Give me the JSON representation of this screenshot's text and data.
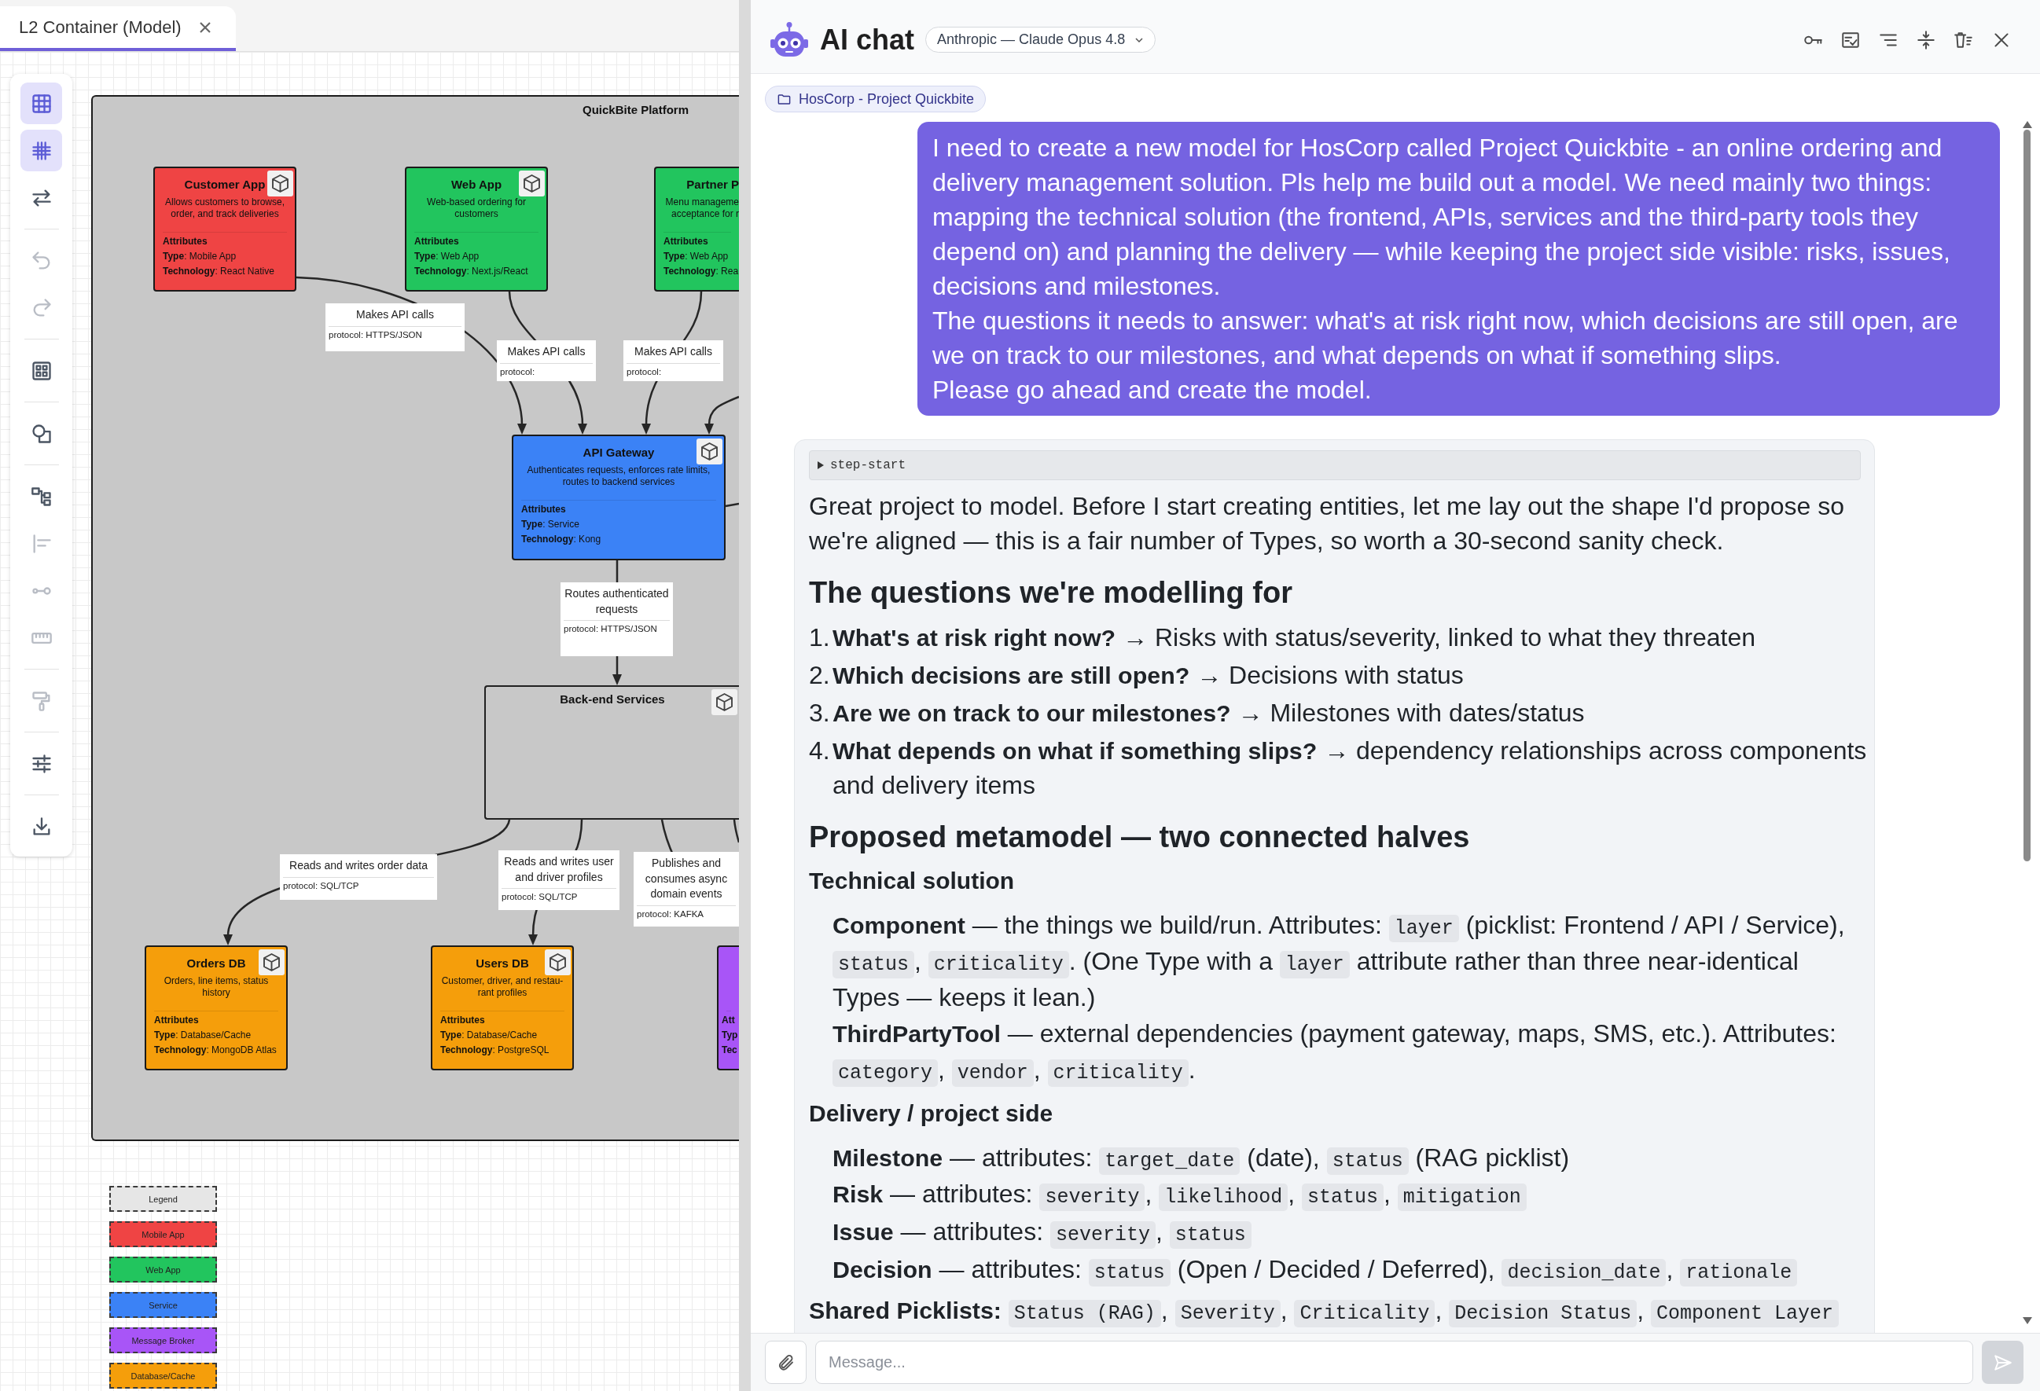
{
  "editor_tab": {
    "title": "L2 Container (Model)",
    "selected": true
  },
  "toolbar": {
    "tools": [
      {
        "on": true,
        "disabled": false
      },
      {
        "on": true,
        "disabled": false
      },
      {
        "on": false,
        "disabled": false
      },
      {
        "on": false,
        "disabled": true
      },
      {
        "on": false,
        "disabled": true
      },
      {
        "on": false,
        "disabled": false
      },
      {
        "on": false,
        "disabled": false
      },
      {
        "on": false,
        "disabled": false
      },
      {
        "on": false,
        "disabled": true
      },
      {
        "on": false,
        "disabled": true
      },
      {
        "on": false,
        "disabled": true
      },
      {
        "on": false,
        "disabled": true
      },
      {
        "on": false,
        "disabled": false
      },
      {
        "on": false,
        "disabled": false
      }
    ]
  },
  "diagram": {
    "title": "QuickBite Platform",
    "nodes": [
      {
        "title": "Customer App",
        "description": "Allows customers to browse, order, and track deliveries",
        "color": "#ef4444",
        "attributes_heading": "Attributes",
        "attributes": [
          "**Type**: Mobile App",
          "**Technology**: React Native"
        ]
      },
      {
        "title": "Web App",
        "description": "Web-based ordering for customers",
        "color": "#22c55e",
        "attributes_heading": "Attributes",
        "attributes": [
          "**Type**: Web App",
          "**Technology**: Next.js/React"
        ]
      },
      {
        "title": "Partner P",
        "description": "Menu manageme\nacceptance for r",
        "color": "#22c55e",
        "attributes_heading": "Attributes",
        "attributes": [
          "**Type**: Web App",
          "**Technology**: Rea"
        ]
      },
      {
        "title": "API Gateway",
        "description": "Authenticates requests, enforces rate limits, routes to backend services",
        "color": "#3b82f6",
        "attributes_heading": "Attributes",
        "attributes": [
          "**Type**: Service",
          "**Technology**: Kong"
        ]
      },
      {
        "title": "Orders DB",
        "description": "Orders, line items, status history",
        "color": "#f59e0b",
        "attributes_heading": "Attributes",
        "attributes": [
          "**Type**: Database/Cache",
          "**Technology**: MongoDB Atlas"
        ]
      },
      {
        "title": "Users DB",
        "description": "Customer, driver, and restau-\nrant profiles",
        "color": "#f59e0b",
        "attributes_heading": "Attributes",
        "attributes": [
          "**Type**: Database/Cache",
          "**Technology**: PostgreSQL"
        ]
      },
      {
        "color": "#a855f7",
        "attributes_heading": "Att",
        "attributes": [
          "**Typ**",
          "**Tec**"
        ]
      }
    ],
    "group_title": "Back-end Services",
    "edges": [
      {
        "label": "Makes API calls",
        "protocol": "protocol: HTTPS/JSON"
      },
      {
        "label": "Makes API calls",
        "protocol": "protocol:"
      },
      {
        "label": "Makes API calls",
        "protocol": "protocol:"
      },
      {
        "label": "Routes authenticated requests",
        "protocol": "protocol: HTTPS/JSON"
      },
      {
        "label": "Reads and writes order data",
        "protocol": "protocol: SQL/TCP"
      },
      {
        "label": "Reads and writes user and driver profiles",
        "protocol": "protocol: SQL/TCP"
      },
      {
        "label": "Publishes and consumes async domain events",
        "protocol": "protocol: KAFKA"
      }
    ]
  },
  "legend": {
    "title": "Legend",
    "items": [
      {
        "label": "Mobile App",
        "color": "#ef4444"
      },
      {
        "label": "Web App",
        "color": "#22c55e"
      },
      {
        "label": "Service",
        "color": "#3b82f6"
      },
      {
        "label": "Message Broker",
        "color": "#a855f7"
      },
      {
        "label": "Database/Cache",
        "color": "#f59e0b"
      }
    ]
  },
  "chat": {
    "title": "AI chat",
    "model": "Anthropic — Claude Opus 4.8",
    "project": "HosCorp - Project Quickbite",
    "messages": [
      {
        "kind": "user",
        "text": "I need to create a new model for HosCorp called Project Quickbite - an online ordering and delivery management solution. Pls help me build out a model. We need mainly two things: mapping the technical solution (the frontend, APIs, services and the third-party tools they depend on) and planning the delivery — while keeping the project side visible: risks, issues, decisions and milestones.\nThe questions it needs to answer: what's at risk right now, which decisions are still open, are we on track to our milestones, and what depends on what if something slips.\nPlease go ahead and create the model."
      },
      {
        "kind": "assistant",
        "step": {
          "label": "step-start",
          "expanded": false
        },
        "blocks": [
          {
            "kind": "paragraph",
            "parts": [
              {
                "kind": "text",
                "text": "Great project to model. Before I start creating entities, let me lay out the shape I'd propose so we're aligned — this is a fair number of Types, so worth a 30-second sanity check."
              }
            ]
          },
          {
            "kind": "heading",
            "text": "The questions we're modelling for"
          },
          {
            "kind": "list",
            "items": [
              {
                "number": "1.",
                "parts": [
                  {
                    "kind": "bold",
                    "text": "What's at risk right now?"
                  },
                  {
                    "kind": "text",
                    "text": " → Risks with status/severity, linked to what they threaten"
                  }
                ]
              },
              {
                "number": "2.",
                "parts": [
                  {
                    "kind": "bold",
                    "text": "Which decisions are still open?"
                  },
                  {
                    "kind": "text",
                    "text": " → Decisions with status"
                  }
                ]
              },
              {
                "number": "3.",
                "parts": [
                  {
                    "kind": "bold",
                    "text": "Are we on track to our milestones?"
                  },
                  {
                    "kind": "text",
                    "text": " → Milestones with dates/status"
                  }
                ]
              },
              {
                "number": "4.",
                "parts": [
                  {
                    "kind": "bold",
                    "text": "What depends on what if something slips?"
                  },
                  {
                    "kind": "text",
                    "text": " → dependency relationships across components and delivery items"
                  }
                ]
              }
            ]
          },
          {
            "kind": "heading",
            "text": "Proposed metamodel — two connected halves"
          },
          {
            "kind": "subheading",
            "text": "Technical solution"
          },
          {
            "kind": "entry",
            "parts": [
              {
                "kind": "bold",
                "text": "Component"
              },
              {
                "kind": "text",
                "text": " — the things we build/run. Attributes: "
              },
              {
                "kind": "code",
                "text": "layer"
              },
              {
                "kind": "text",
                "text": " (picklist: Frontend / API / Service), "
              },
              {
                "kind": "code",
                "text": "status"
              },
              {
                "kind": "text",
                "text": ", "
              },
              {
                "kind": "code",
                "text": "criticality"
              },
              {
                "kind": "text",
                "text": ". (One Type with a "
              },
              {
                "kind": "code",
                "text": "layer"
              },
              {
                "kind": "text",
                "text": " attribute rather than three near-identical Types — keeps it lean.)"
              }
            ]
          },
          {
            "kind": "entry",
            "parts": [
              {
                "kind": "bold",
                "text": "ThirdPartyTool"
              },
              {
                "kind": "text",
                "text": " — external dependencies (payment gateway, maps, SMS, etc.). Attributes: "
              },
              {
                "kind": "code",
                "text": "category"
              },
              {
                "kind": "text",
                "text": ", "
              },
              {
                "kind": "code",
                "text": "vendor"
              },
              {
                "kind": "text",
                "text": ", "
              },
              {
                "kind": "code",
                "text": "criticality"
              },
              {
                "kind": "text",
                "text": "."
              }
            ]
          },
          {
            "kind": "subheading",
            "text": "Delivery / project side"
          },
          {
            "kind": "entry",
            "parts": [
              {
                "kind": "bold",
                "text": "Milestone"
              },
              {
                "kind": "text",
                "text": " — attributes: "
              },
              {
                "kind": "code",
                "text": "target_date"
              },
              {
                "kind": "text",
                "text": " (date), "
              },
              {
                "kind": "code",
                "text": "status"
              },
              {
                "kind": "text",
                "text": " (RAG picklist)"
              }
            ]
          },
          {
            "kind": "entry",
            "parts": [
              {
                "kind": "bold",
                "text": "Risk"
              },
              {
                "kind": "text",
                "text": " — attributes: "
              },
              {
                "kind": "code",
                "text": "severity"
              },
              {
                "kind": "text",
                "text": ", "
              },
              {
                "kind": "code",
                "text": "likelihood"
              },
              {
                "kind": "text",
                "text": ", "
              },
              {
                "kind": "code",
                "text": "status"
              },
              {
                "kind": "text",
                "text": ", "
              },
              {
                "kind": "code",
                "text": "mitigation"
              }
            ]
          },
          {
            "kind": "entry",
            "parts": [
              {
                "kind": "bold",
                "text": "Issue"
              },
              {
                "kind": "text",
                "text": " — attributes: "
              },
              {
                "kind": "code",
                "text": "severity"
              },
              {
                "kind": "text",
                "text": ", "
              },
              {
                "kind": "code",
                "text": "status"
              }
            ]
          },
          {
            "kind": "entry",
            "parts": [
              {
                "kind": "bold",
                "text": "Decision"
              },
              {
                "kind": "text",
                "text": " — attributes: "
              },
              {
                "kind": "code",
                "text": "status"
              },
              {
                "kind": "text",
                "text": " (Open / Decided / Deferred), "
              },
              {
                "kind": "code",
                "text": "decision_date"
              },
              {
                "kind": "text",
                "text": ", "
              },
              {
                "kind": "code",
                "text": "rationale"
              }
            ]
          },
          {
            "kind": "paragraph",
            "parts": [
              {
                "kind": "bold",
                "text": "Shared Picklists:"
              },
              {
                "kind": "code",
                "text": "Status (RAG)"
              },
              {
                "kind": "text",
                "text": ", "
              },
              {
                "kind": "code",
                "text": "Severity"
              },
              {
                "kind": "text",
                "text": ", "
              },
              {
                "kind": "code",
                "text": "Criticality"
              },
              {
                "kind": "text",
                "text": ", "
              },
              {
                "kind": "code",
                "text": "Decision Status"
              },
              {
                "kind": "text",
                "text": ", "
              },
              {
                "kind": "code",
                "text": "Component Layer"
              }
            ]
          }
        ]
      }
    ],
    "composer": {
      "placeholder": "Message...",
      "send_button": {
        "disabled": true
      }
    }
  }
}
